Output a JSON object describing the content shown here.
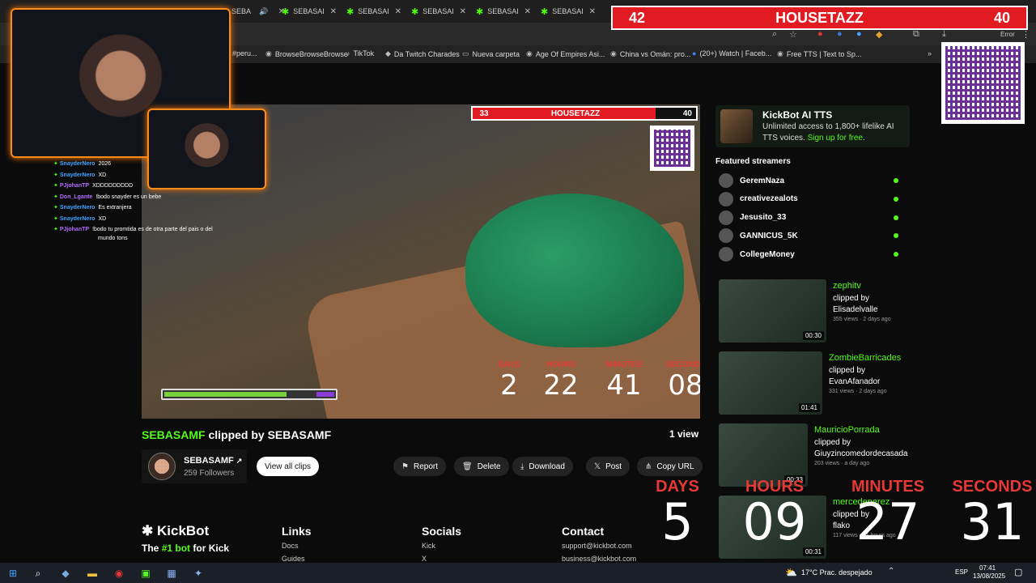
{
  "tabs": [
    {
      "label": "SEBA",
      "audio": "speaker-icon"
    },
    {
      "label": "SEBASAI"
    },
    {
      "label": "SEBASAI"
    },
    {
      "label": "SEBASAI"
    },
    {
      "label": "SEBASAI"
    },
    {
      "label": "SEBASAI"
    }
  ],
  "toolbar": {
    "error_label": "Error"
  },
  "bookmarks": [
    {
      "label": "#peru..."
    },
    {
      "label": "BrowseBrowseBrowse"
    },
    {
      "label": "TikTok"
    },
    {
      "label": "Da Twitch Charades"
    },
    {
      "label": "Nueva carpeta"
    },
    {
      "label": "Age Of Empires Asi..."
    },
    {
      "label": "China vs Omán: pro..."
    },
    {
      "label": "(20+) Watch | Faceb..."
    },
    {
      "label": "Free TTS | Text to Sp..."
    }
  ],
  "top_overlay": {
    "left_score": "42",
    "title": "HOUSETAZZ",
    "right_score": "40"
  },
  "video_overlay": {
    "left_score": "33",
    "title": "HOUSETAZZ",
    "right_score": "40"
  },
  "video_countdown": {
    "labels": [
      "DAYS",
      "HOURS",
      "MINUTES",
      "SECONDS"
    ],
    "values": [
      "2",
      "22",
      "41",
      "08"
    ]
  },
  "big_countdown": {
    "labels": [
      "DAYS",
      "HOURS",
      "MINUTES",
      "SECONDS"
    ],
    "values": [
      "5",
      "09",
      "27",
      "31"
    ]
  },
  "video_bar": {
    "health_fraction": 0.72
  },
  "chat": [
    {
      "name": "SnayderNero",
      "text": "2026",
      "color": "blue"
    },
    {
      "name": "SnayderNero",
      "text": "XD",
      "color": "blue"
    },
    {
      "name": "PJjohanTP",
      "text": "XDDDDDDDDD",
      "color": "purple"
    },
    {
      "name": "Don_Lgante",
      "text": "!bodo snayder es un bebe",
      "color": "purple"
    },
    {
      "name": "SnayderNero",
      "text": "Es extranjera",
      "color": "blue"
    },
    {
      "name": "SnayderNero",
      "text": "XD",
      "color": "blue"
    },
    {
      "name": "PJjohanTP",
      "text": "!bodo tu promtida es de otra parte del pais o del",
      "color": "purple"
    }
  ],
  "chat_continuation": "mundo tons",
  "clip": {
    "channel": "SEBASAMF",
    "clipped_by_text": "clipped by",
    "clipper": "SEBASAMF",
    "views": "1 view",
    "streamer_name": "SEBASAMF",
    "followers": "259 Followers",
    "view_all": "View all clips",
    "actions": [
      "Report",
      "Delete",
      "Download",
      "Post",
      "Copy URL"
    ]
  },
  "promo": {
    "title": "KickBot AI TTS",
    "desc": "Unlimited access to 1,800+ lifelike AI TTS voices.",
    "link": "Sign up for free",
    "period": "."
  },
  "featured": {
    "heading": "Featured streamers",
    "items": [
      "GeremNaza",
      "creativezealots",
      "Jesusito_33",
      "GANNICUS_5K",
      "CollegeMoney"
    ]
  },
  "side_clips": [
    {
      "name": "zephitv",
      "by_label": "clipped by",
      "clipper": "Elisadelvalle",
      "meta": "355 views · 2 days ago",
      "duration": "00:30"
    },
    {
      "name": "ZombieBarricades",
      "by_label": "clipped by",
      "clipper": "EvanAfanador",
      "meta": "331 views · 2 days ago",
      "duration": "01:41"
    },
    {
      "name": "MauricioPorrada",
      "by_label": "clipped by",
      "clipper": "Giuyzincomedordecasada",
      "meta": "203 views · a day ago",
      "duration": "00:33"
    },
    {
      "name": "mercedeperez",
      "by_label": "clipped by",
      "clipper": "flako",
      "meta": "117 views · 21 hours ago",
      "duration": "00:31"
    }
  ],
  "footer": {
    "brand": "KickBot",
    "tagline_pre": "The",
    "tagline_hl": "#1 bot",
    "tagline_post": "for Kick",
    "links_heading": "Links",
    "links": [
      "Docs",
      "Guides"
    ],
    "socials_heading": "Socials",
    "socials": [
      "Kick",
      "X"
    ],
    "contact_heading": "Contact",
    "contact": [
      "support@kickbot.com",
      "business@kickbot.com"
    ]
  },
  "taskbar": {
    "weather": "17°C  Prac. despejado",
    "lang": "ESP",
    "time": "07:41",
    "date": "13/08/2025"
  },
  "colors": {
    "kick_green": "#53fc18",
    "accent_red": "#e21b23",
    "cam_border": "#ff8c1a"
  }
}
